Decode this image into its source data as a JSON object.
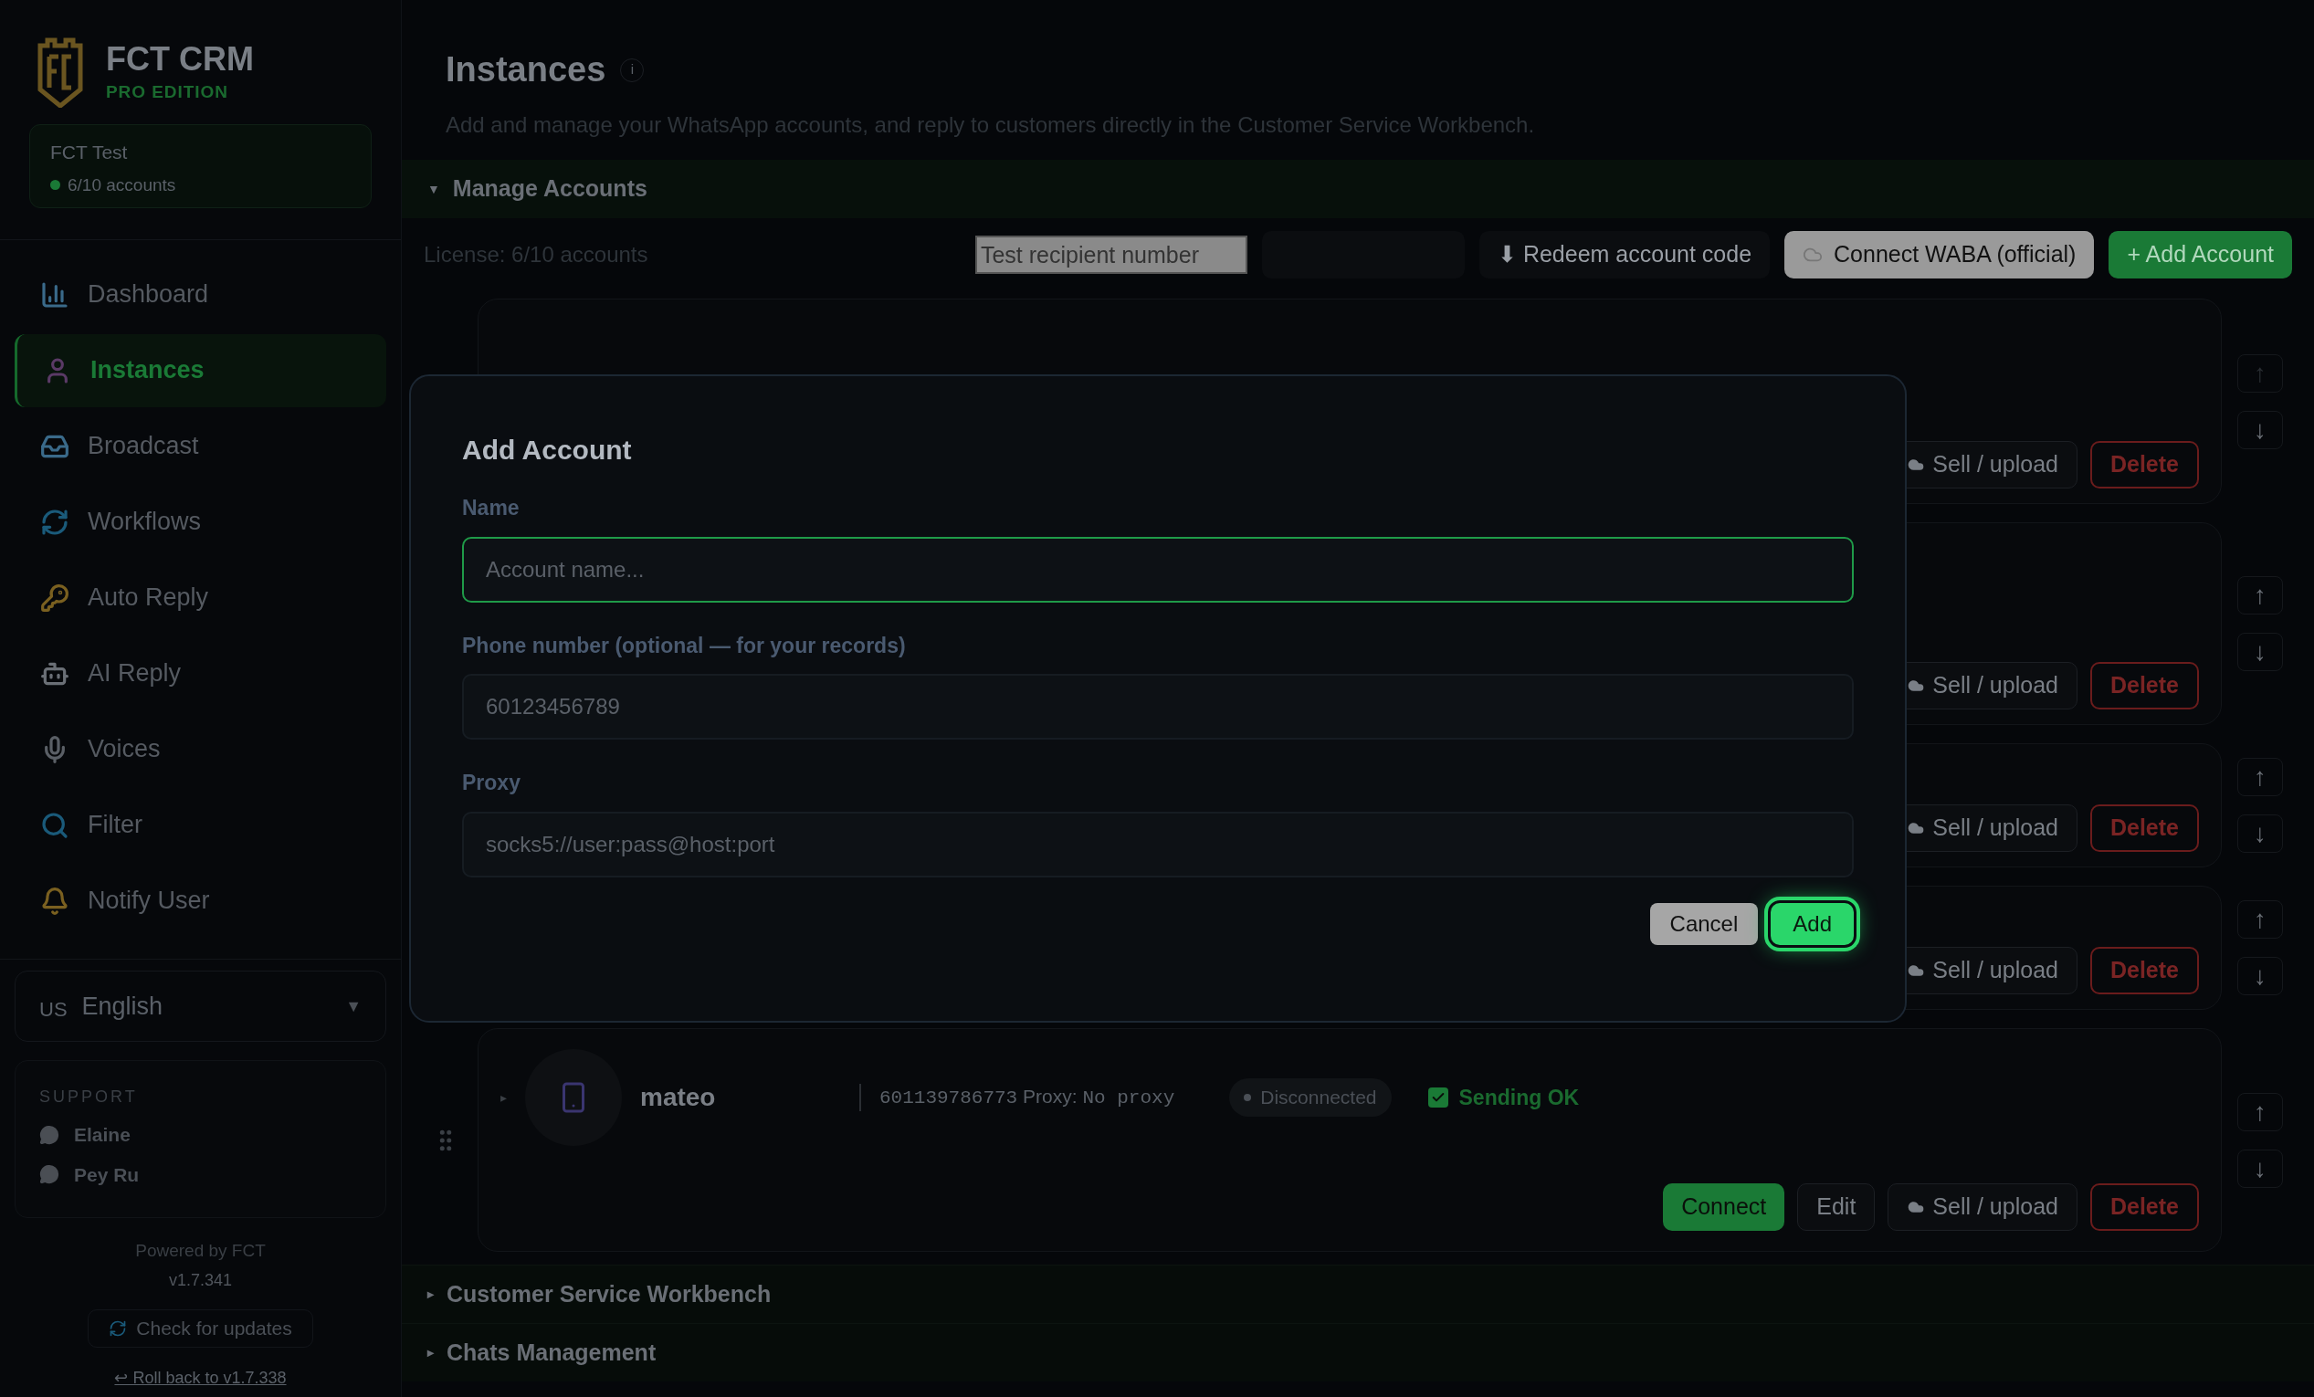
{
  "sidebar": {
    "brand": {
      "name": "FCT CRM",
      "edition": "PRO EDITION"
    },
    "account": {
      "name": "FCT Test",
      "accounts": "6/10 accounts",
      "online": true
    },
    "nav": [
      {
        "label": "Dashboard",
        "selected": false
      },
      {
        "label": "Instances",
        "selected": true
      },
      {
        "label": "Broadcast",
        "selected": false
      },
      {
        "label": "Workflows",
        "selected": false
      },
      {
        "label": "Auto Reply",
        "selected": false
      },
      {
        "label": "AI Reply",
        "selected": false
      },
      {
        "label": "Voices",
        "selected": false
      },
      {
        "label": "Filter",
        "selected": false
      },
      {
        "label": "Notify User",
        "selected": false
      }
    ],
    "language": {
      "flag": "US",
      "label": "English",
      "caret": "▼"
    },
    "support": {
      "title": "SUPPORT",
      "contacts": [
        "Elaine",
        "Pey Ru"
      ]
    },
    "footer": {
      "powered": "Powered by FCT",
      "version": "v1.7.341",
      "update_button": "Check for updates",
      "rollback_link": "↩ Roll back to v1.7.338"
    }
  },
  "page": {
    "title": "Instances",
    "info": "i",
    "subtitle": "Add and manage your WhatsApp accounts, and reply to customers directly in the Customer Service Workbench."
  },
  "manage": {
    "title": "Manage Accounts",
    "caret": "▼",
    "expanded": true,
    "license": "License: 6/10 accounts",
    "toolbar": {
      "recipient_placeholder": "Test recipient number",
      "redeem": "⬇ Redeem account code",
      "waba": "Connect WABA (official)",
      "add": "+ Add Account"
    },
    "cards": [
      {
        "kind": "hidden",
        "sell": "Sell / upload",
        "delete": "Delete",
        "up": "↑",
        "down": "↓",
        "up_disabled": true
      },
      {
        "kind": "hidden",
        "sell": "Sell / upload",
        "delete": "Delete",
        "up": "↑",
        "down": "↓",
        "up_disabled": false
      },
      {
        "kind": "hidden",
        "sell": "Sell / upload",
        "delete": "Delete",
        "up": "↑",
        "down": "↓",
        "up_disabled": false
      },
      {
        "kind": "hidden",
        "sell": "Sell / upload",
        "delete": "Delete",
        "up": "↑",
        "down": "↓",
        "up_disabled": false
      },
      {
        "kind": "full",
        "caret": "▸",
        "name": "mateo",
        "phone": "601139786773",
        "proxy_label": "Proxy:",
        "proxy": "No proxy",
        "status": "Disconnected",
        "connected": false,
        "sending": "Sending OK",
        "sending_ok": true,
        "connect": "Connect",
        "edit": "Edit",
        "sell": "Sell / upload",
        "delete": "Delete",
        "up": "↑",
        "down": "↓",
        "up_disabled": false
      }
    ]
  },
  "sections": [
    {
      "title": "Customer Service Workbench",
      "caret": "▸",
      "expanded": false
    },
    {
      "title": "Chats Management",
      "caret": "▸",
      "expanded": false
    }
  ],
  "dialog": {
    "title": "Add Account",
    "fields": [
      {
        "label": "Name",
        "placeholder": "Account name...",
        "focused": true
      },
      {
        "label": "Phone number (optional — for your records)",
        "placeholder": "60123456789",
        "focused": false
      },
      {
        "label": "Proxy",
        "placeholder": "socks5://user:pass@host:port",
        "focused": false
      }
    ],
    "cancel": "Cancel",
    "add": "Add"
  }
}
